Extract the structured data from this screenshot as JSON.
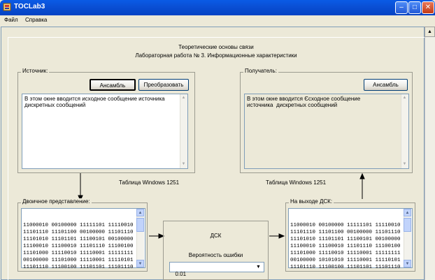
{
  "window": {
    "title": "TOCLab3"
  },
  "menu": {
    "file": "Файл",
    "help": "Справка"
  },
  "header": {
    "line1": "Теоретические основы связи",
    "line2": "Лабораторная работа № 3. Информационные характеристики"
  },
  "source": {
    "label": "Источник:",
    "ensemble_button": "Ансамбль",
    "transform_button": "Преобразовать",
    "text": "В этом окне вводится исходное сообщение источника\nдискретных сообщений"
  },
  "receiver": {
    "label": "Получатель:",
    "ensemble_button": "Ансамбль",
    "text": "В этом окне вводится Єсходное сообщение\nисточника  дискретных сообщений"
  },
  "encoding": {
    "left": "Таблица Windows 1251",
    "right": "Таблица Windows 1251"
  },
  "binary": {
    "label": "Двоичное представление:",
    "lines": [
      "11000010 00100000 11111101 11110010",
      "11101110 11101100 00100000 11101110",
      "11101010 11101101 11100101 00100000",
      "11100010 11100010 11101110 11100100",
      "11101000 11110010 11110001 11111111",
      "00100000 11101000 11110001 11110101",
      "11101110 11100100 11101101 11101110"
    ]
  },
  "dsk": {
    "title": "ДСК",
    "error_label": "Вероятность ошибки",
    "error_value": "0.01"
  },
  "output": {
    "label": "На выходе ДСК:",
    "lines": [
      "11000010 00100000 11111101 11110010",
      "11101110 11101100 00100000 11101110",
      "11101010 11101101 11100101 00100000",
      "11100010 11100010 11101110 11100100",
      "11101000 11110010 11110001 11111111",
      "00100000 10101010 11110001 11110101",
      "11101110 11100100 11101101 11101110"
    ]
  },
  "colors": {
    "titlebar": "#0a4fd4",
    "window_bg": "#ece9d8"
  }
}
